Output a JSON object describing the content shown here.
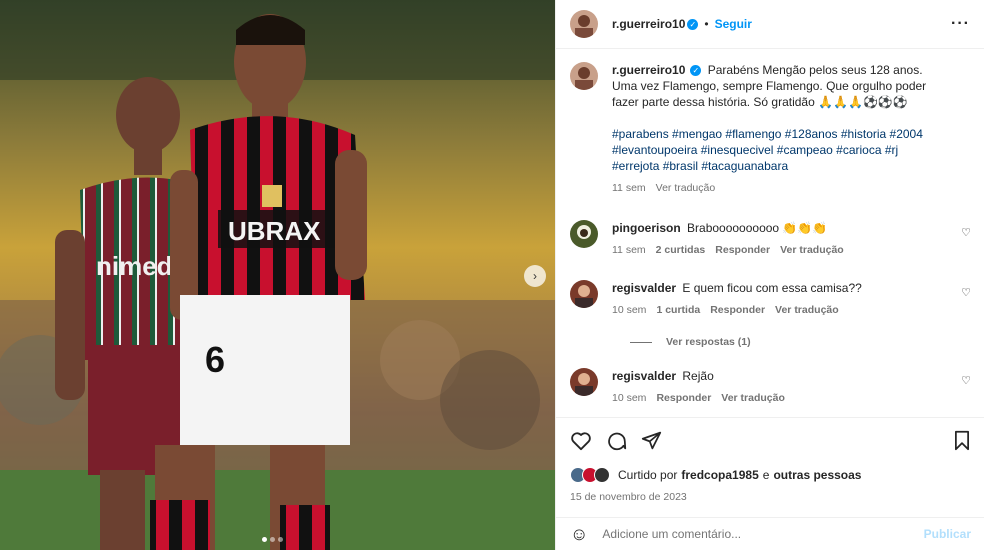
{
  "post": {
    "author": "r.guerreiro10",
    "follow_label": "Seguir",
    "more_icon": "more-options-icon",
    "dot": "•"
  },
  "caption": {
    "author": "r.guerreiro10",
    "text": "Parabéns Mengão pelos seus 128 anos. Uma vez Flamengo, sempre Flamengo. Que orgulho poder fazer parte dessa história. Só gratidão 🙏🙏🙏⚽⚽⚽",
    "hashtags": "#parabens #mengao #flamengo #128anos #historia #2004 #levantoupoeira #inesquecivel #campeao #carioca #rj #errejota #brasil #tacaguanabara",
    "time": "11 sem",
    "translate": "Ver tradução"
  },
  "comments": [
    {
      "user": "pingoerison",
      "text": "Braboooooooooo 👏👏👏",
      "time": "11 sem",
      "likes": "2 curtidas",
      "reply": "Responder",
      "translate": "Ver tradução"
    },
    {
      "user": "regisvalder",
      "text": "E quem ficou com essa camisa??",
      "time": "10 sem",
      "likes": "1 curtida",
      "reply": "Responder",
      "translate": "Ver tradução",
      "view_replies": "Ver respostas (1)"
    },
    {
      "user": "regisvalder",
      "text": "Rejão",
      "time": "10 sem",
      "reply": "Responder",
      "translate": "Ver tradução"
    }
  ],
  "likes": {
    "prefix": "Curtido por",
    "user": "fredcopa1985",
    "conj": "e",
    "others": "outras pessoas"
  },
  "date": "15 de novembro de 2023",
  "add_comment": {
    "placeholder": "Adicione um comentário...",
    "publish": "Publicar"
  },
  "photo": {
    "sponsor_text": "UBRAX",
    "shirt_number": "6",
    "sponsor_left": "nimed"
  },
  "colors": {
    "accent": "#0095f6",
    "link": "#00376b",
    "muted": "#737373",
    "flamengo_red": "#c8102e",
    "fluminense_maroon": "#7a1f2b"
  }
}
